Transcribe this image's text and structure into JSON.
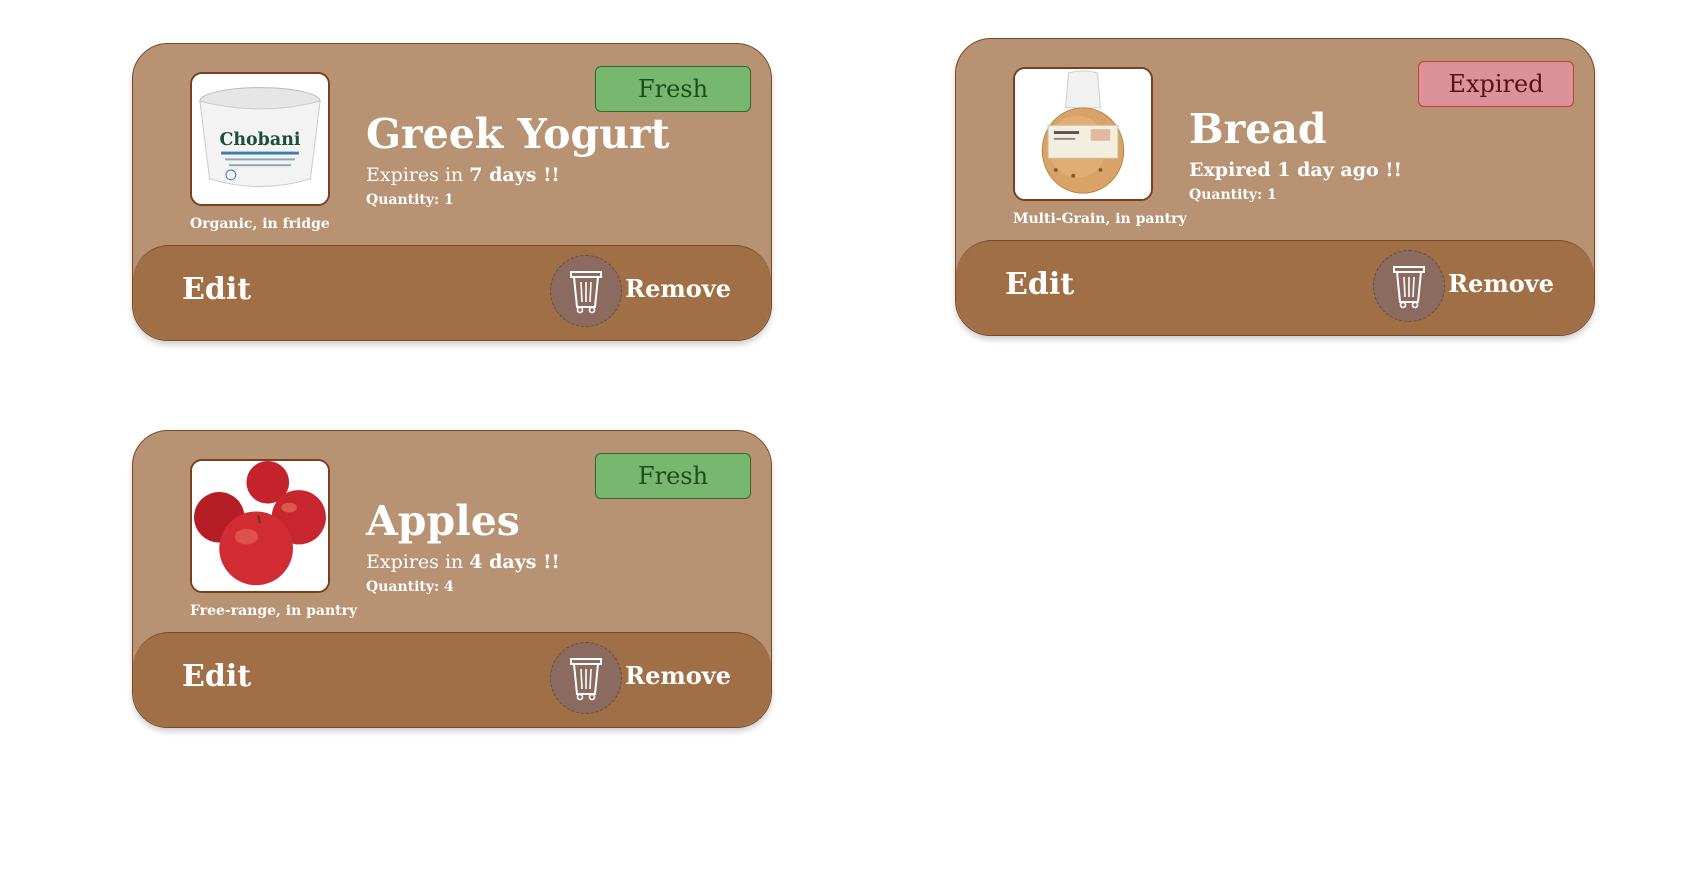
{
  "items": [
    {
      "name": "Greek Yogurt",
      "status": "Fresh",
      "expiry_prefix": "Expires in ",
      "expiry_strong": "7 days !!",
      "quantity": "Quantity: 1",
      "caption": "Organic, in fridge",
      "thumb_brand": "Chobani",
      "edit_label": "Edit",
      "remove_label": "Remove"
    },
    {
      "name": "Bread",
      "status": "Expired",
      "expiry_text": "Expired 1 day ago !!",
      "quantity": "Quantity: 1",
      "caption": "Multi-Grain, in pantry",
      "edit_label": "Edit",
      "remove_label": "Remove"
    },
    {
      "name": "Apples",
      "status": "Fresh",
      "expiry_prefix": "Expires in ",
      "expiry_strong": "4 days !!",
      "quantity": "Quantity: 4",
      "caption": "Free-range, in pantry",
      "edit_label": "Edit",
      "remove_label": "Remove"
    }
  ],
  "colors": {
    "card_bg": "#b89373",
    "footer_bg": "#a06f46",
    "fresh_badge": "#78b76f",
    "expired_badge": "#d99399",
    "trash_circle": "#8b6a60"
  },
  "icons": {
    "trash": "trash-can-icon"
  }
}
